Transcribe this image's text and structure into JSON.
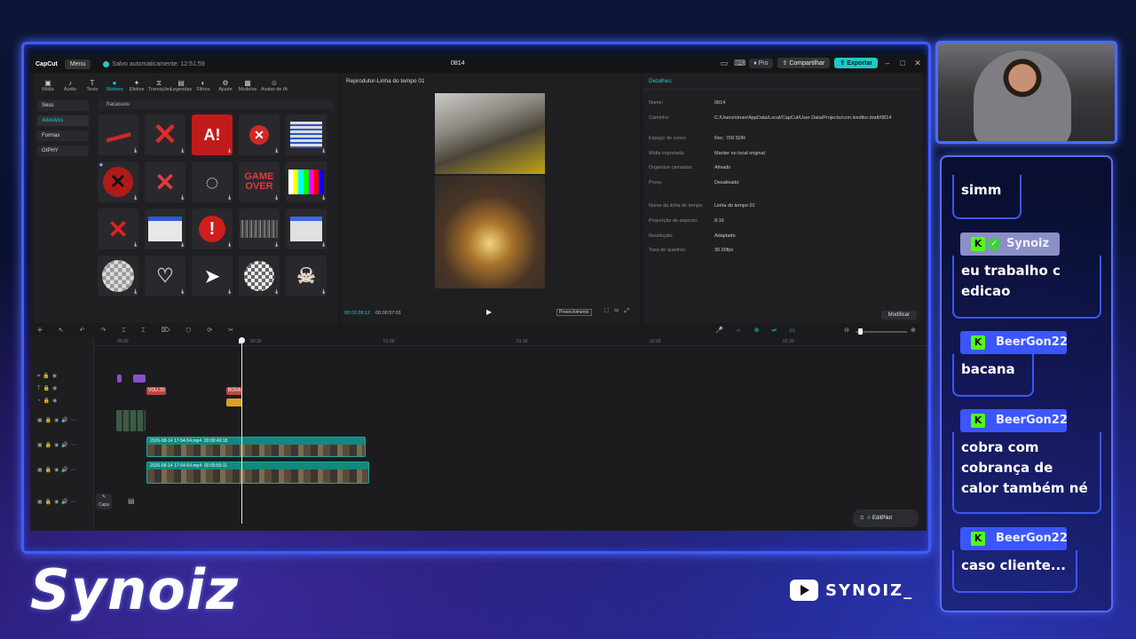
{
  "app": {
    "logo": "CapCut",
    "menu_label": "Menu",
    "autosave": "Salvo automaticamente: 12:51:59",
    "project_name": "0814",
    "pro_label": "Pro",
    "share_label": "Compartilhar",
    "export_label": "Exportar",
    "accent": "#1fc9c9"
  },
  "tools": [
    {
      "label": "Mídia",
      "icon": "media-icon"
    },
    {
      "label": "Áudio",
      "icon": "audio-icon"
    },
    {
      "label": "Texto",
      "icon": "text-icon"
    },
    {
      "label": "Stickers",
      "icon": "sticker-icon"
    },
    {
      "label": "Efeitos",
      "icon": "effects-icon"
    },
    {
      "label": "Transições",
      "icon": "transitions-icon"
    },
    {
      "label": "Legendas",
      "icon": "captions-icon"
    },
    {
      "label": "Filtros",
      "icon": "filters-icon"
    },
    {
      "label": "Ajuste",
      "icon": "adjust-icon"
    },
    {
      "label": "Modelos",
      "icon": "templates-icon"
    },
    {
      "label": "Avatar de IA",
      "icon": "ai-avatar-icon"
    }
  ],
  "categories": [
    "Seus",
    "Adesivos",
    "Formas",
    "GIPHY"
  ],
  "search": {
    "value": "fracassou"
  },
  "player": {
    "title": "Reprodutor-Linha do tempo 01",
    "current_time": "00:00:28:12",
    "total_time": "00:00:57:01",
    "fill_label": "Preenchimento"
  },
  "details": {
    "title": "Detalhes",
    "rows": [
      {
        "label": "Nome:",
        "value": "0814"
      },
      {
        "label": "Caminho:",
        "value": "C:/Users/sbner/AppData/Local/CapCut/User Data/Projects/com.lveditor.draft/0814"
      },
      {
        "label": "Espaço de cores:",
        "value": "Rec. 709 SDR"
      },
      {
        "label": "Mídia importada:",
        "value": "Manter no local original"
      },
      {
        "label": "Organizar camadas:",
        "value": "Ativado"
      },
      {
        "label": "Proxy:",
        "value": "Desativado"
      },
      {
        "label": "Nome da linha do tempo:",
        "value": "Linha do tempo 01"
      },
      {
        "label": "Proporção de aspecto:",
        "value": "9:16"
      },
      {
        "label": "Resolução:",
        "value": "Adaptado"
      },
      {
        "label": "Taxa de quadros:",
        "value": "30.00fps"
      }
    ],
    "modify_label": "Modificar"
  },
  "timeline": {
    "ruler": [
      "00:00",
      "00:30",
      "01:00",
      "01:30",
      "02:00",
      "02:30"
    ],
    "text_clips": [
      "VOU JO",
      "BORA"
    ],
    "video_clips": [
      {
        "name": "2026-08-14 17-54-54.mp4",
        "duration": "00:00:49:18"
      },
      {
        "name": "2026-08-14 17-54-54.mp4",
        "duration": "00:00:50:11"
      }
    ],
    "capa_label": "Capa",
    "editpilot_label": "EditPilot"
  },
  "chat": [
    {
      "user": "",
      "text": "simm",
      "partial": true
    },
    {
      "user": "Synoiz",
      "text": "eu trabalho c edicao",
      "verified": true
    },
    {
      "user": "BeerGon22",
      "text": "bacana"
    },
    {
      "user": "BeerGon22",
      "text": "cobra com cobrança de calor também né"
    },
    {
      "user": "BeerGon22",
      "text": "caso cliente..."
    }
  ],
  "brand": {
    "name": "Synoiz",
    "youtube_handle": "SYNOIZ_"
  }
}
